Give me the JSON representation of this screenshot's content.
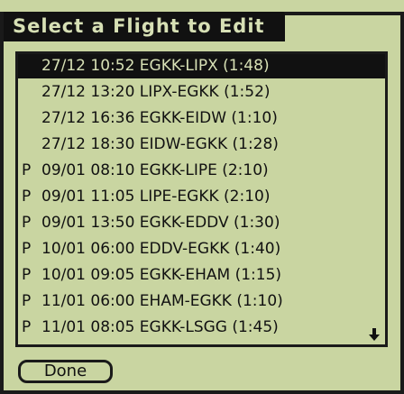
{
  "title": "Select a Flight to Edit",
  "flights": [
    {
      "flag": "",
      "text": "27/12 10:52 EGKK-LIPX (1:48)",
      "selected": true
    },
    {
      "flag": "",
      "text": "27/12 13:20 LIPX-EGKK (1:52)",
      "selected": false
    },
    {
      "flag": "",
      "text": "27/12 16:36 EGKK-EIDW (1:10)",
      "selected": false
    },
    {
      "flag": "",
      "text": "27/12 18:30 EIDW-EGKK (1:28)",
      "selected": false
    },
    {
      "flag": "P",
      "text": "09/01 08:10 EGKK-LIPE (2:10)",
      "selected": false
    },
    {
      "flag": "P",
      "text": "09/01 11:05 LIPE-EGKK (2:10)",
      "selected": false
    },
    {
      "flag": "P",
      "text": "09/01 13:50 EGKK-EDDV (1:30)",
      "selected": false
    },
    {
      "flag": "P",
      "text": "10/01 06:00 EDDV-EGKK (1:40)",
      "selected": false
    },
    {
      "flag": "P",
      "text": "10/01 09:05 EGKK-EHAM (1:15)",
      "selected": false
    },
    {
      "flag": "P",
      "text": "11/01 06:00 EHAM-EGKK (1:10)",
      "selected": false
    },
    {
      "flag": "P",
      "text": "11/01 08:05 EGKK-LSGG (1:45)",
      "selected": false
    }
  ],
  "scroll_icon": "arrow-down-icon",
  "done_label": "Done",
  "colors": {
    "background": "#c9d5a1",
    "ink": "#111111"
  }
}
